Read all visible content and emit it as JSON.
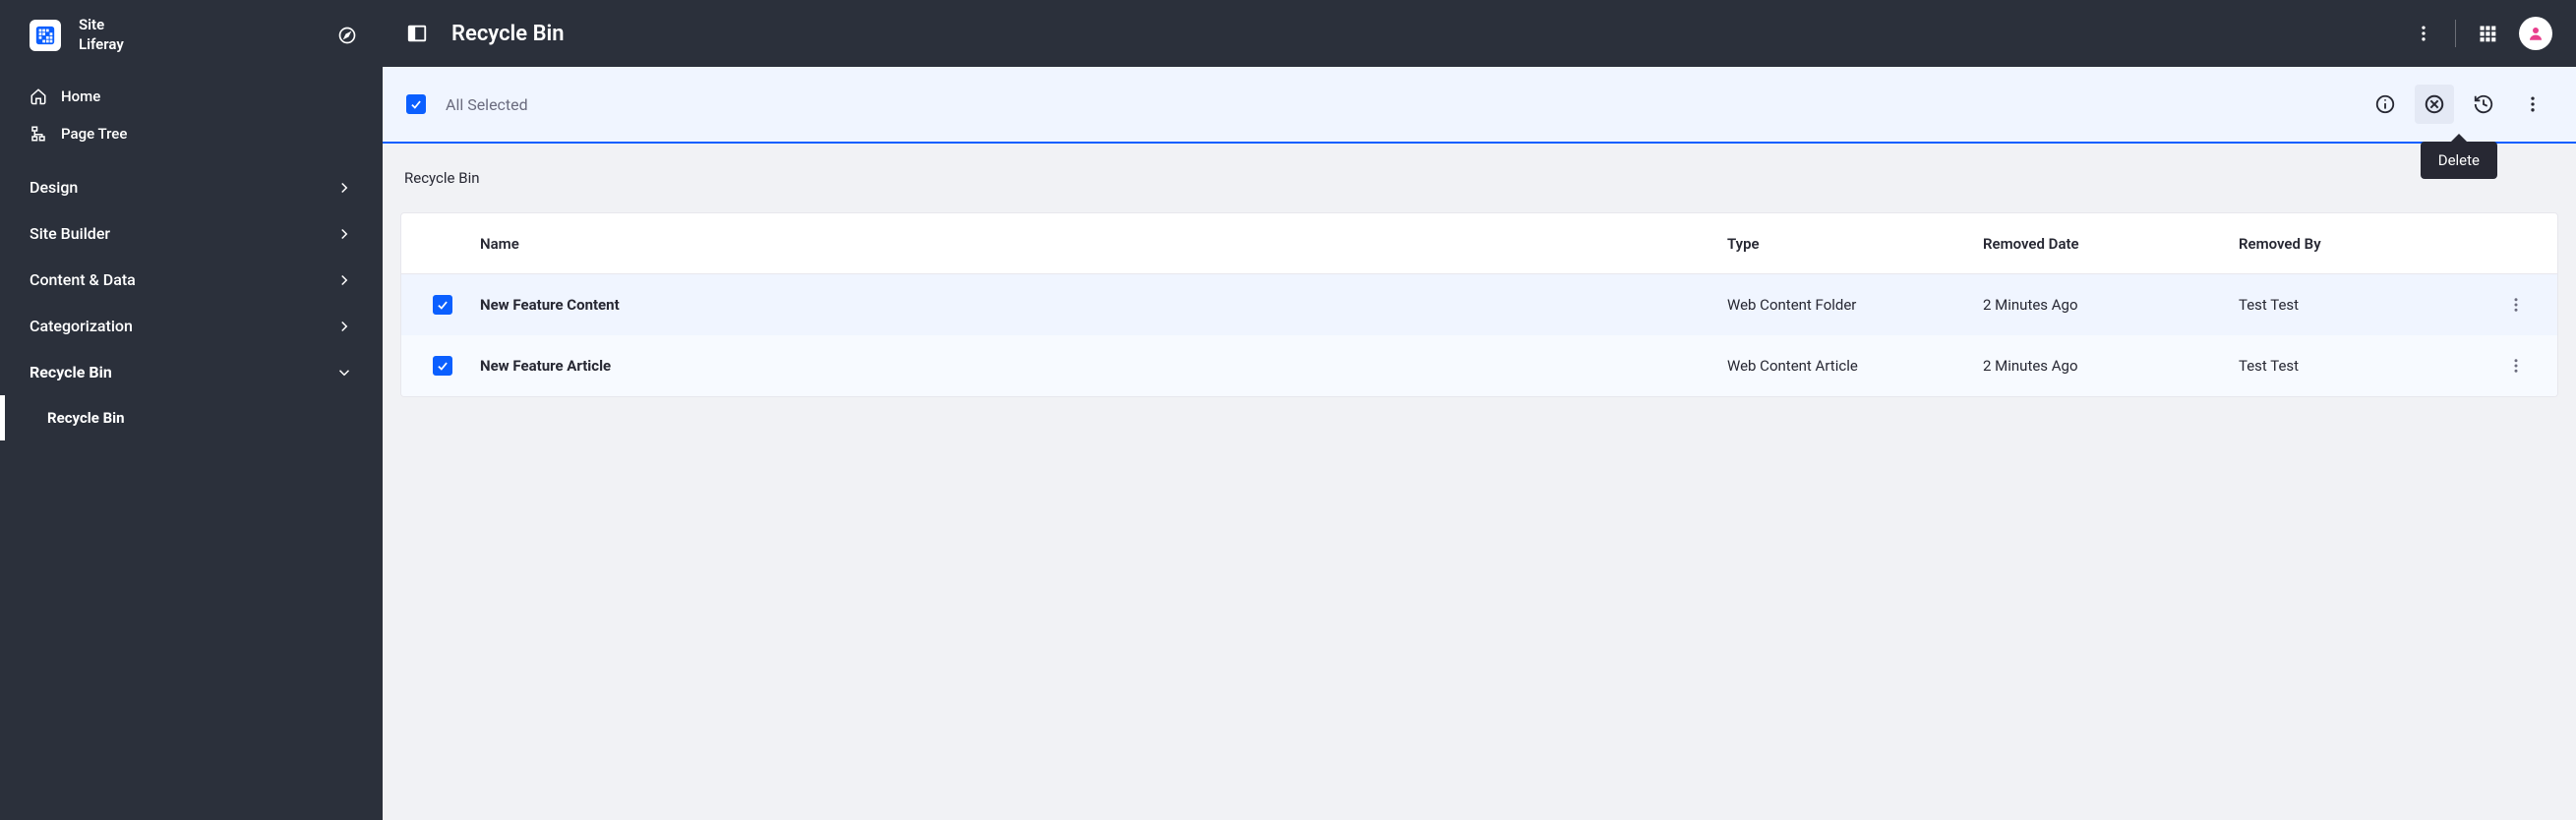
{
  "sidebar": {
    "title1": "Site",
    "title2": "Liferay",
    "home": "Home",
    "page_tree": "Page Tree",
    "cats": [
      {
        "label": "Design"
      },
      {
        "label": "Site Builder"
      },
      {
        "label": "Content & Data"
      },
      {
        "label": "Categorization"
      },
      {
        "label": "Recycle Bin",
        "expanded": true
      }
    ],
    "sub_active": "Recycle Bin"
  },
  "topbar": {
    "title": "Recycle Bin"
  },
  "mgmt": {
    "selection_text": "All Selected",
    "tooltip_delete": "Delete"
  },
  "breadcrumb": "Recycle Bin",
  "table": {
    "headers": {
      "name": "Name",
      "type": "Type",
      "removed_date": "Removed Date",
      "removed_by": "Removed By"
    },
    "rows": [
      {
        "name": "New Feature Content",
        "type": "Web Content Folder",
        "removed_date": "2 Minutes Ago",
        "removed_by": "Test Test"
      },
      {
        "name": "New Feature Article",
        "type": "Web Content Article",
        "removed_date": "2 Minutes Ago",
        "removed_by": "Test Test"
      }
    ]
  }
}
